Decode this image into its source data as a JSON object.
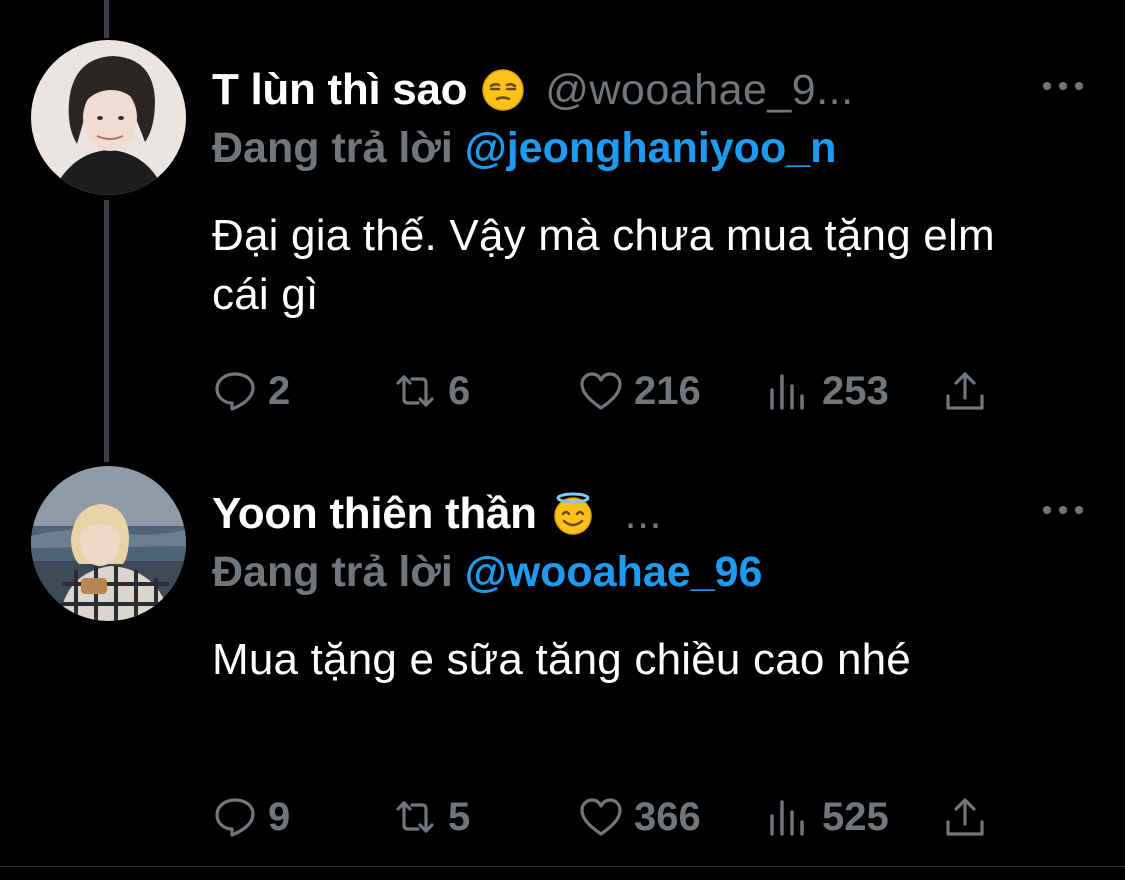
{
  "colors": {
    "background": "#000000",
    "text": "#ffffff",
    "muted": "#71767b",
    "link": "#1d9bf0",
    "thread_line": "#3a3d42"
  },
  "tweets": [
    {
      "display_name": "T lùn thì sao",
      "emoji": "unamused-face",
      "handle": "@wooahae_9...",
      "replying_prefix": "Đang trả lời",
      "replying_to": "@jeonghaniyoo_n",
      "text": "Đại gia thế. Vậy mà chưa mua tặng elm cái gì",
      "replies": "2",
      "retweets": "6",
      "likes": "216",
      "views": "253"
    },
    {
      "display_name": "Yoon thiên thần",
      "emoji": "smiling-face-with-halo",
      "handle": "...",
      "replying_prefix": "Đang trả lời",
      "replying_to": "@wooahae_96",
      "text": "Mua tặng e sữa tăng chiều cao nhé",
      "replies": "9",
      "retweets": "5",
      "likes": "366",
      "views": "525"
    }
  ],
  "icons": [
    "reply-icon",
    "retweet-icon",
    "like-icon",
    "views-icon",
    "share-icon",
    "more-icon"
  ]
}
